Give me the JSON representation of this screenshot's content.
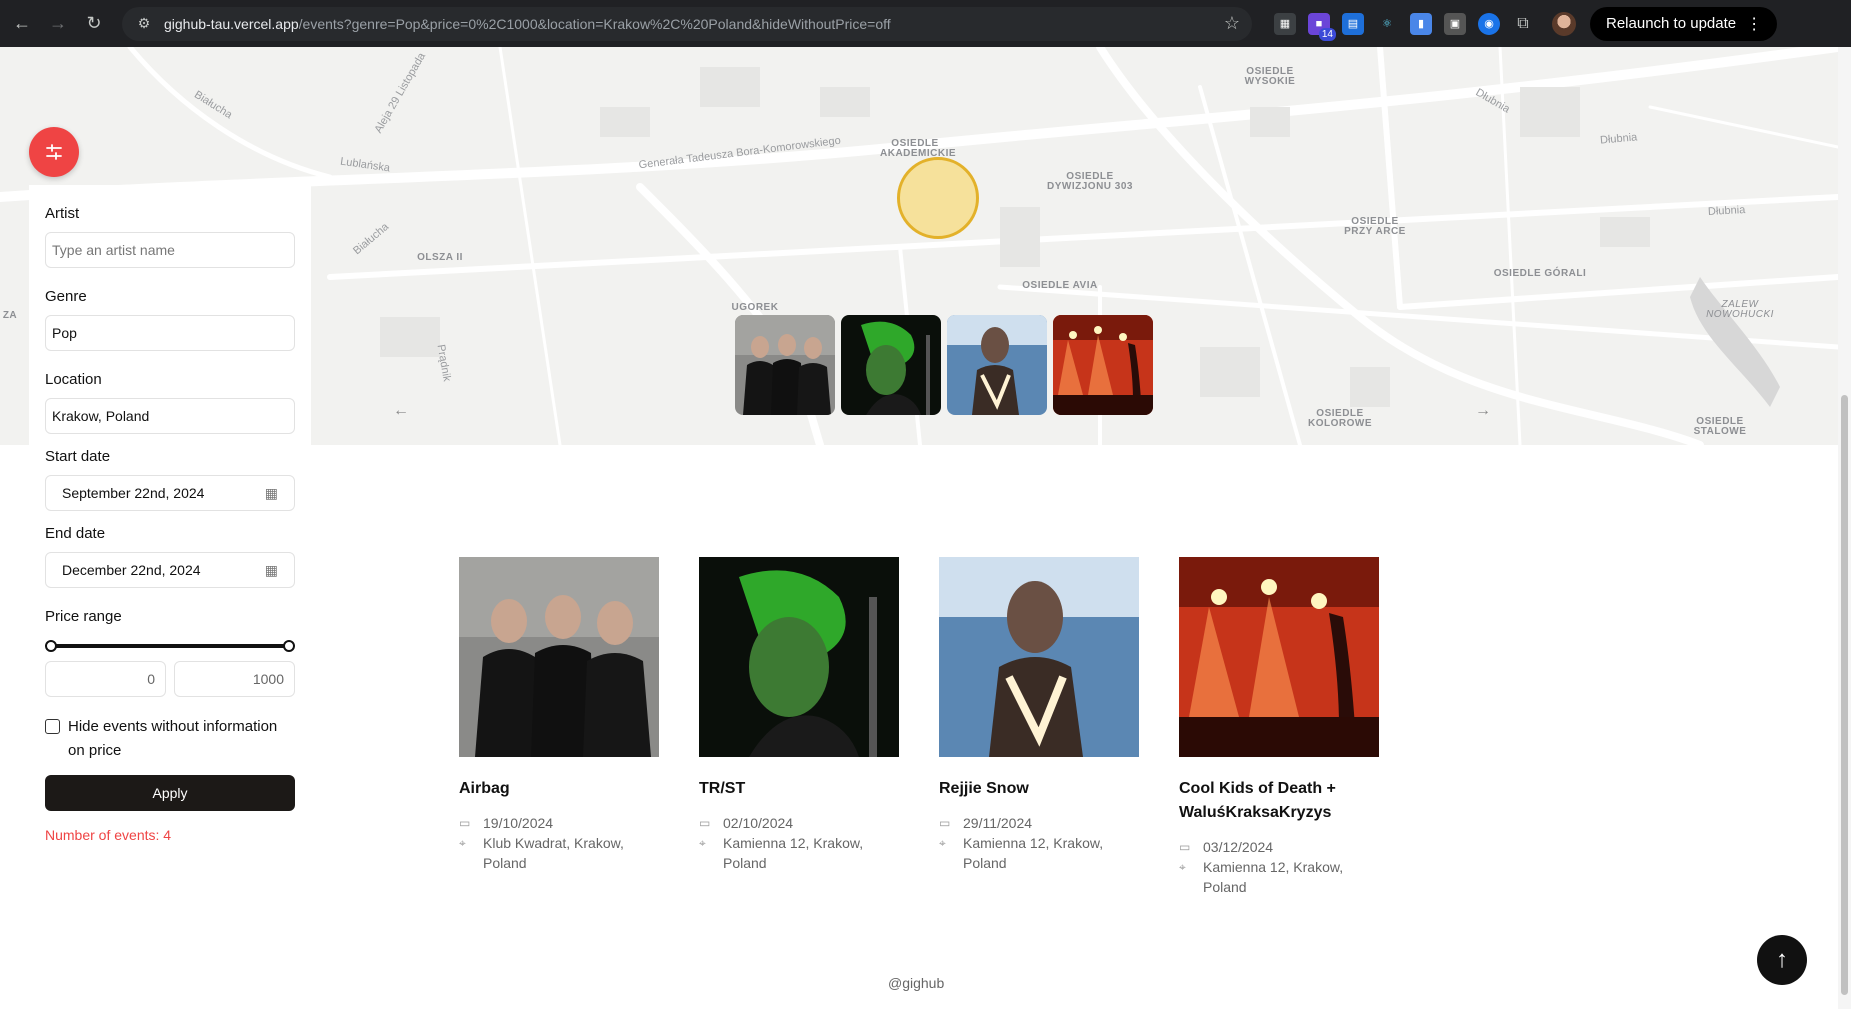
{
  "browser": {
    "url_host": "gighub-tau.vercel.app",
    "url_rest": "/events?genre=Pop&price=0%2C1000&location=Krakow%2C%20Poland&hideWithoutPrice=off",
    "ext_badge": "14",
    "relaunch_label": "Relaunch to update"
  },
  "map": {
    "labels": {
      "osiedle_wysokie": "OSIEDLE WYSOKIE",
      "osiedle_akademickie": "OSIEDLE AKADEMICKIE",
      "osiedle_dywizjonu": "OSIEDLE DYWIZJONU 303",
      "osiedle_przy_arce": "OSIEDLE PRZY ARCE",
      "osiedle_gorali": "OSIEDLE GÓRALI",
      "osiedle_avia": "OSIEDLE AVIA",
      "olsza": "OLSZA II",
      "ugorek": "UGOREK",
      "osiedle_kolorowe": "OSIEDLE KOLOROWE",
      "osiedle_stalowe": "OSIEDLE STALOWE",
      "zalew": "Zalew Nowohucki",
      "za": "ZA"
    },
    "roads": {
      "bora": "Generała Tadeusza Bora-Komorowskiego",
      "lublanska": "Lublańska",
      "aleja29": "Aleja 29 Listopada",
      "bialucha1": "Białucha",
      "bialucha2": "Białucha",
      "dlubnia1": "Dłubnia",
      "dlubnia2": "Dłubnia",
      "dlubnia3": "Dłubnia",
      "kriv": "Prądnik"
    }
  },
  "filters": {
    "artist_label": "Artist",
    "artist_placeholder": "Type an artist name",
    "genre_label": "Genre",
    "genre_value": "Pop",
    "location_label": "Location",
    "location_value": "Krakow, Poland",
    "start_label": "Start date",
    "start_value": "September 22nd, 2024",
    "end_label": "End date",
    "end_value": "December 22nd, 2024",
    "price_label": "Price range",
    "price_min": "0",
    "price_max": "1000",
    "price_range_fraction": [
      0,
      1
    ],
    "hide_label": "Hide events without information on price",
    "apply_label": "Apply",
    "count_label": "Number of events: 4"
  },
  "events": [
    {
      "title": "Airbag",
      "date": "19/10/2024",
      "venue": "Klub Kwadrat, Krakow,",
      "country": "Poland"
    },
    {
      "title": "TR/ST",
      "date": "02/10/2024",
      "venue": "Kamienna 12, Krakow,",
      "country": "Poland"
    },
    {
      "title": "Rejjie Snow",
      "date": "29/11/2024",
      "venue": "Kamienna 12, Krakow,",
      "country": "Poland"
    },
    {
      "title": "Cool Kids of Death + WaluśKraksaKryzys",
      "date": "03/12/2024",
      "venue": "Kamienna 12, Krakow,",
      "country": "Poland"
    }
  ],
  "footer": "@gighub",
  "colors": {
    "accent": "#ef4444",
    "marker": "#e3b12a",
    "dark": "#1c1917"
  }
}
